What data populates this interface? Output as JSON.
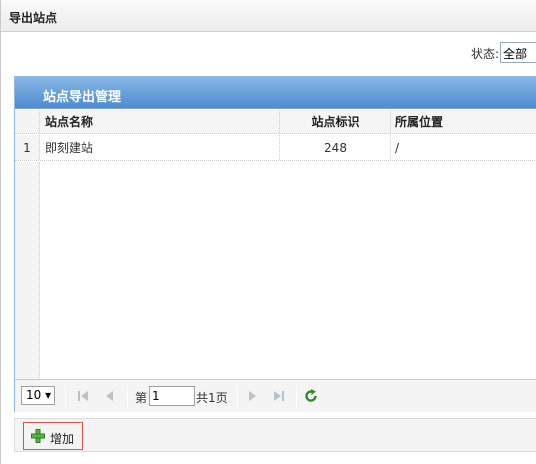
{
  "dialog": {
    "title": "导出站点"
  },
  "filter": {
    "status_label": "状态:",
    "status_value": "全部"
  },
  "panel": {
    "title": "站点导出管理"
  },
  "grid": {
    "columns": {
      "name": "站点名称",
      "id": "站点标识",
      "location": "所属位置"
    },
    "rows": [
      {
        "num": "1",
        "name": "即刻建站",
        "id": "248",
        "location": "/"
      }
    ]
  },
  "pager": {
    "page_size": "10 ▾",
    "page_prefix": "第",
    "page_value": "1",
    "page_total": "共1页"
  },
  "toolbar": {
    "add_label": "增加"
  },
  "colors": {
    "header_blue": "#4f8ccf",
    "add_icon_green": "#3c9a2f",
    "refresh_green": "#2e8b2e",
    "highlight_red": "#d9534f"
  }
}
